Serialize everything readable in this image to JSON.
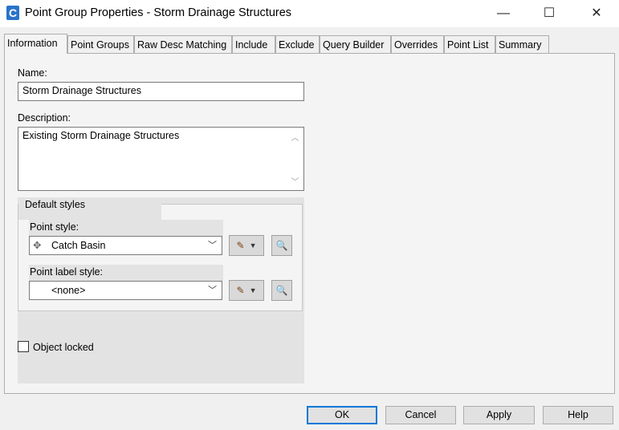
{
  "window": {
    "title": "Point Group Properties - Storm Drainage Structures",
    "app_icon": "civil3d-icon",
    "minimize": "—",
    "maximize": "☐",
    "close": "✕"
  },
  "tabs": [
    {
      "label": "Information",
      "active": true
    },
    {
      "label": "Point Groups"
    },
    {
      "label": "Raw Desc Matching"
    },
    {
      "label": "Include"
    },
    {
      "label": "Exclude"
    },
    {
      "label": "Query Builder"
    },
    {
      "label": "Overrides"
    },
    {
      "label": "Point List"
    },
    {
      "label": "Summary"
    }
  ],
  "info": {
    "name_label": "Name:",
    "name_value": "Storm Drainage Structures",
    "description_label": "Description:",
    "description_value": "Existing Storm Drainage Structures",
    "default_styles_label": "Default styles",
    "point_style_label": "Point style:",
    "point_style_value": "Catch Basin",
    "point_label_style_label": "Point label style:",
    "point_label_style_value": "<none>",
    "object_locked_label": "Object locked",
    "object_locked": false
  },
  "buttons": {
    "ok": "OK",
    "cancel": "Cancel",
    "apply": "Apply",
    "help": "Help"
  }
}
